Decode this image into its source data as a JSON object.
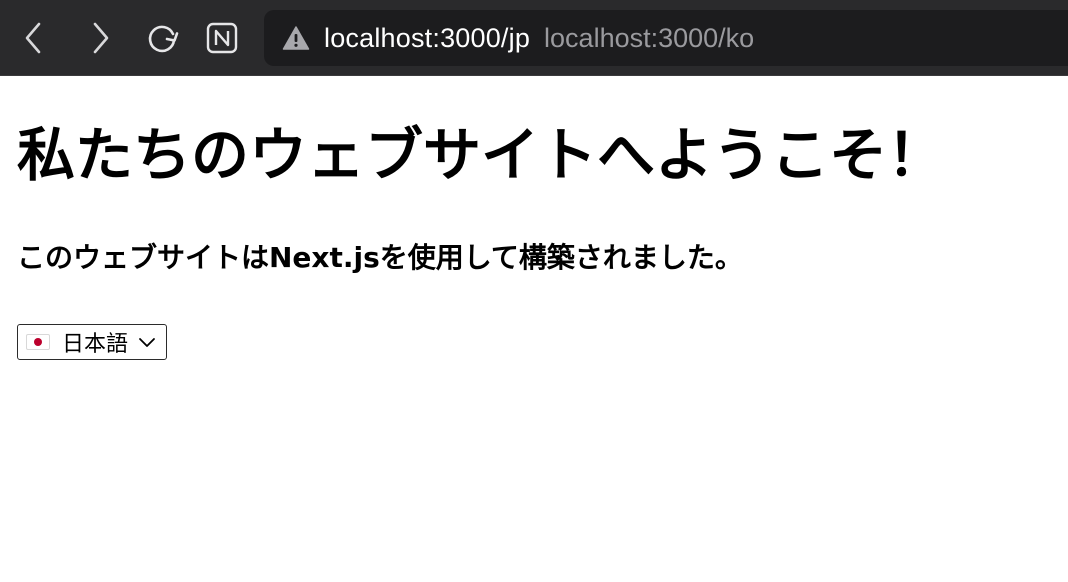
{
  "browser": {
    "url": "localhost:3000/jp",
    "suggestion": "localhost:3000/ko",
    "toolbar_icons": [
      "chevron-left-icon",
      "chevron-right-icon",
      "reload-icon",
      "notion-extension-icon",
      "warning-icon"
    ]
  },
  "page": {
    "heading": "私たちのウェブサイトへようこそ！",
    "subtitle": "このウェブサイトはNext.jsを使用して構築されました。",
    "language_select": {
      "selected_label": "日本語",
      "flag": "japan-flag-icon"
    }
  },
  "colors": {
    "toolbar_bg": "#2a2a2c",
    "urlbar_bg": "#1c1c1e",
    "url_text": "#ffffff",
    "suggestion_text": "#9a9a9e",
    "flag_red": "#bc002d"
  }
}
